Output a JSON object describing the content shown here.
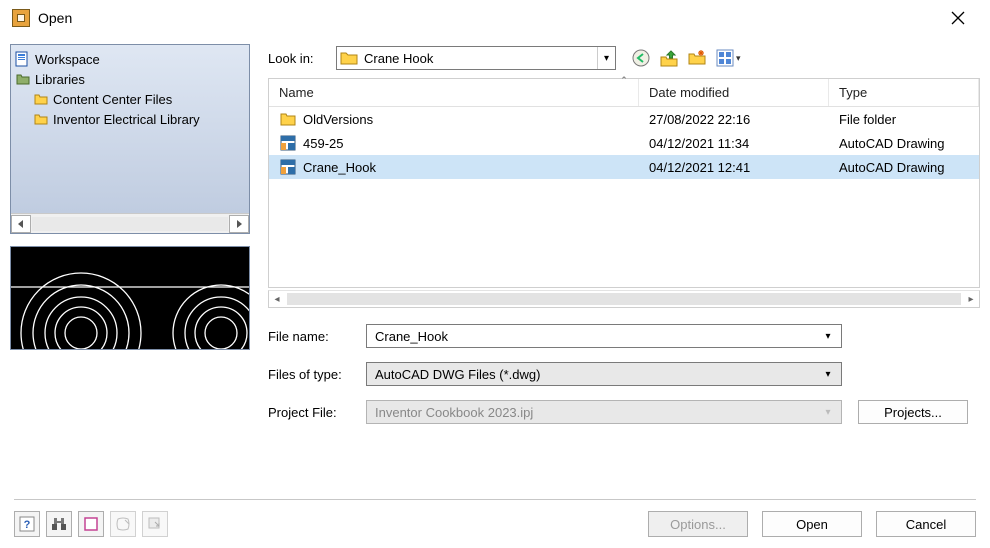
{
  "window": {
    "title": "Open"
  },
  "sidebar": {
    "items": [
      {
        "label": "Workspace",
        "icon": "workspace"
      },
      {
        "label": "Libraries",
        "icon": "libraries"
      },
      {
        "label": "Content Center Files",
        "icon": "folder"
      },
      {
        "label": "Inventor Electrical Library",
        "icon": "folder"
      }
    ]
  },
  "lookin": {
    "label": "Look in:",
    "value": "Crane Hook"
  },
  "columns": {
    "name": "Name",
    "date": "Date modified",
    "type": "Type"
  },
  "files": [
    {
      "name": "OldVersions",
      "date": "27/08/2022 22:16",
      "type": "File folder",
      "icon": "folder"
    },
    {
      "name": "459-25",
      "date": "04/12/2021 11:34",
      "type": "AutoCAD Drawing",
      "icon": "dwg"
    },
    {
      "name": "Crane_Hook",
      "date": "04/12/2021 12:41",
      "type": "AutoCAD Drawing",
      "icon": "dwg",
      "selected": true
    }
  ],
  "form": {
    "filename_label": "File name:",
    "filename_value": "Crane_Hook",
    "filetype_label": "Files of type:",
    "filetype_value": "AutoCAD DWG Files (*.dwg)",
    "project_label": "Project File:",
    "project_value": "Inventor Cookbook 2023.ipj",
    "projects_button": "Projects..."
  },
  "buttons": {
    "options": "Options...",
    "open": "Open",
    "cancel": "Cancel"
  }
}
